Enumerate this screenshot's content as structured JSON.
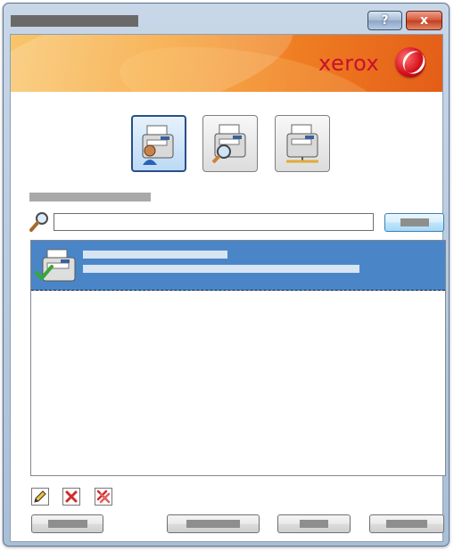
{
  "window": {
    "title": "",
    "help_label": "?",
    "close_label": "x"
  },
  "banner": {
    "brand": "xerox"
  },
  "modes": [
    {
      "icon": "printer-user-icon",
      "selected": true
    },
    {
      "icon": "printer-search-icon",
      "selected": false
    },
    {
      "icon": "printer-network-icon",
      "selected": false
    }
  ],
  "search": {
    "section_label": "",
    "placeholder": "",
    "value": "",
    "button_label": ""
  },
  "printer_list": {
    "items": [
      {
        "name": "",
        "detail": "",
        "icon": "printer-check-icon",
        "selected": true
      }
    ]
  },
  "toolbar": {
    "edit_icon": "pencil-icon",
    "delete_icon": "delete-icon",
    "delete_all_icon": "delete-all-icon"
  },
  "footer": {
    "left_button_label": "",
    "button2_label": "",
    "button3_label": "",
    "button4_label": ""
  },
  "colors": {
    "selection": "#4a86c7",
    "brand_red": "#c8102e",
    "banner_orange": "#f7a436"
  }
}
